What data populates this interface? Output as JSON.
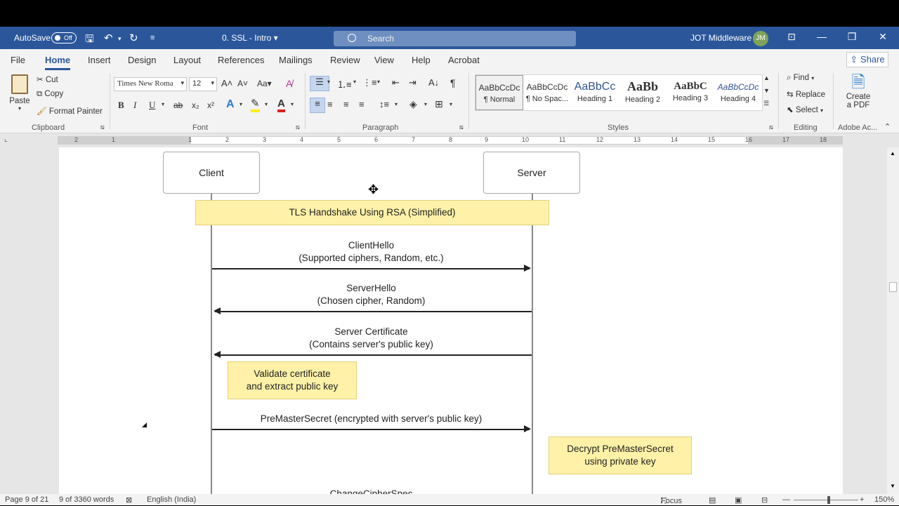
{
  "titlebar": {
    "autosave_label": "AutoSave",
    "autosave_state": "Off",
    "doc_name": "0. SSL - Intro",
    "search_placeholder": "Search",
    "user_name": "JOT Middleware",
    "avatar_initials": "JM"
  },
  "tabs": [
    "File",
    "Home",
    "Insert",
    "Design",
    "Layout",
    "References",
    "Mailings",
    "Review",
    "View",
    "Help",
    "Acrobat"
  ],
  "active_tab": "Home",
  "share_label": "Share",
  "clipboard": {
    "paste": "Paste",
    "cut": "Cut",
    "copy": "Copy",
    "format_painter": "Format Painter",
    "label": "Clipboard"
  },
  "font": {
    "name": "Times New Roma",
    "size": "12",
    "label": "Font",
    "buttons": [
      "B",
      "I",
      "U",
      "ab",
      "x₂",
      "x²"
    ]
  },
  "paragraph": {
    "label": "Paragraph"
  },
  "styles": {
    "label": "Styles",
    "items": [
      {
        "sample": "AaBbCcDc",
        "name": "¶ Normal"
      },
      {
        "sample": "AaBbCcDc",
        "name": "¶ No Spac..."
      },
      {
        "sample": "AaBbCc",
        "name": "Heading 1"
      },
      {
        "sample": "AaBb",
        "name": "Heading 2"
      },
      {
        "sample": "AaBbC",
        "name": "Heading 3"
      },
      {
        "sample": "AaBbCcDc",
        "name": "Heading 4"
      }
    ]
  },
  "editing": {
    "find": "Find",
    "replace": "Replace",
    "select": "Select",
    "label": "Editing"
  },
  "adobe": {
    "create_pdf_line1": "Create",
    "create_pdf_line2": "a PDF",
    "label": "Adobe Ac..."
  },
  "ruler_ticks": [
    "2",
    "1",
    "1",
    "2",
    "3",
    "4",
    "5",
    "6",
    "7",
    "8",
    "9",
    "10",
    "11",
    "12",
    "13",
    "14",
    "15",
    "16",
    "17",
    "18"
  ],
  "diagram": {
    "client": "Client",
    "server": "Server",
    "title": "TLS Handshake Using RSA (Simplified)",
    "msg1_line1": "ClientHello",
    "msg1_line2": "(Supported ciphers, Random, etc.)",
    "msg2_line1": "ServerHello",
    "msg2_line2": "(Chosen cipher, Random)",
    "msg3_line1": "Server Certificate",
    "msg3_line2": "(Contains server's public key)",
    "note1_line1": "Validate certificate",
    "note1_line2": "and extract public key",
    "msg4": "PreMasterSecret (encrypted with server's public key)",
    "note2_line1": "Decrypt PreMasterSecret",
    "note2_line2": "using private key",
    "msg5": "ChangeCipherSpec"
  },
  "status": {
    "page": "Page 9 of 21",
    "words": "9 of 3360 words",
    "language": "English (India)",
    "focus": "Focus",
    "zoom": "150%"
  }
}
